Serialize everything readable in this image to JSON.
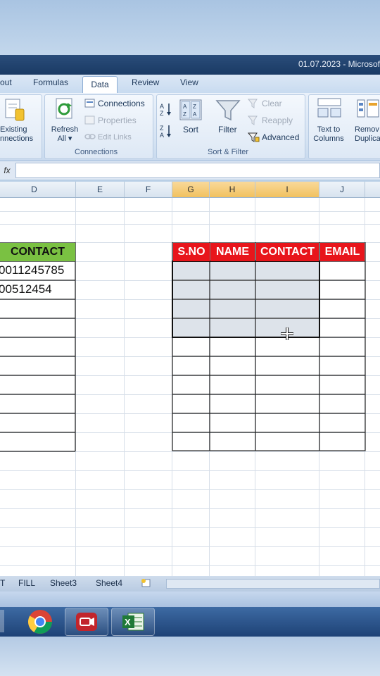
{
  "window": {
    "title": "01.07.2023 - Microsof"
  },
  "tabs": [
    {
      "label": "out"
    },
    {
      "label": "Formulas"
    },
    {
      "label": "Data"
    },
    {
      "label": "Review"
    },
    {
      "label": "View"
    }
  ],
  "ribbon": {
    "existing_line1": "Existing",
    "existing_line2": "nnections",
    "refresh_line1": "Refresh",
    "refresh_line2": "All ▾",
    "connections": "Connections",
    "properties": "Properties",
    "edit_links": "Edit Links",
    "group_connections": "Connections",
    "sort_az": "A↓Z",
    "sort": "Sort",
    "sort_za": "Z↓A",
    "filter": "Filter",
    "clear": "Clear",
    "reapply": "Reapply",
    "advanced": "Advanced",
    "group_sort_filter": "Sort & Filter",
    "text_to_line1": "Text to",
    "text_to_line2": "Columns",
    "remove_line1": "Remov",
    "remove_line2": "Duplica"
  },
  "formula_bar": {
    "fx": "fx",
    "value": ""
  },
  "columns": [
    "D",
    "E",
    "F",
    "G",
    "H",
    "I",
    "J"
  ],
  "left_table": {
    "header": "CONTACT",
    "rows": [
      "0011245785",
      "00512454"
    ],
    "header_color": "#7ac142"
  },
  "right_table": {
    "headers": [
      "S.NO",
      "NAME",
      "CONTACT",
      "EMAIL"
    ],
    "header_color": "#e8151b",
    "header_text_color": "#ffffff"
  },
  "sheet_tabs": [
    "T",
    "FILL",
    "Sheet3",
    "Sheet4"
  ],
  "taskbar": {
    "items": [
      "chrome-icon",
      "recorder-icon",
      "excel-icon"
    ]
  }
}
